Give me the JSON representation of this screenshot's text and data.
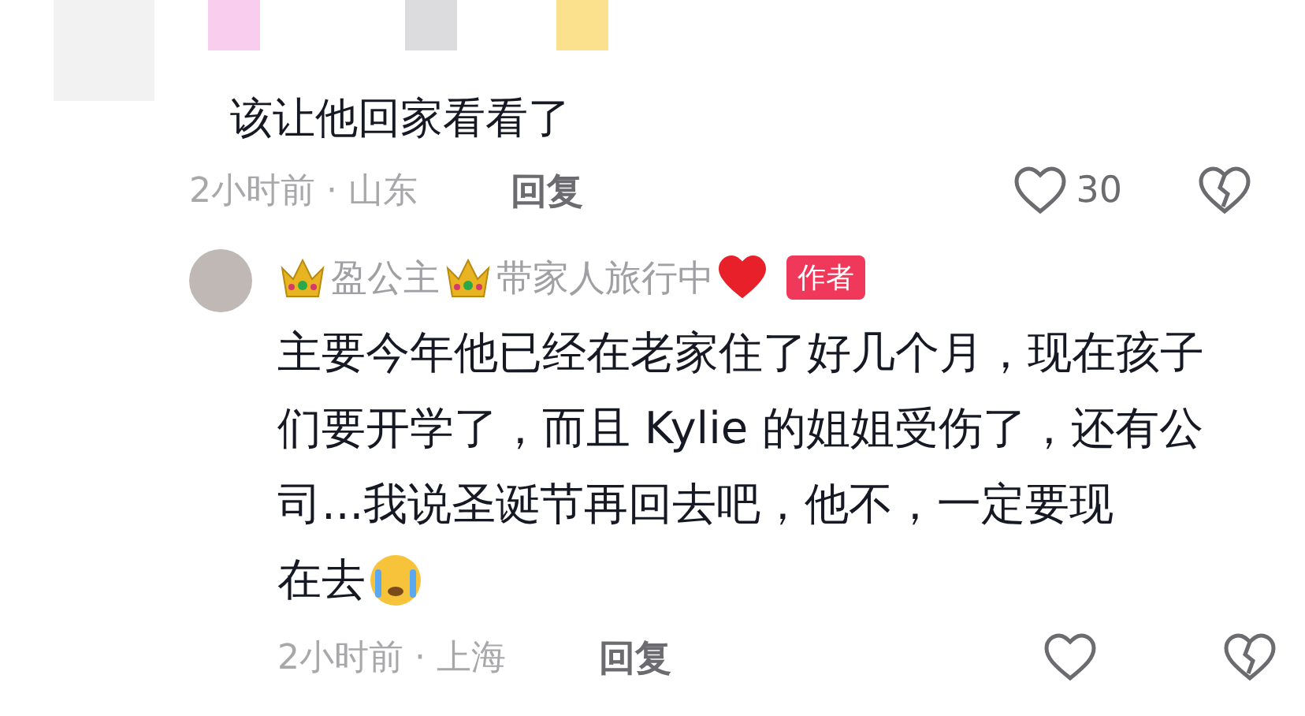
{
  "top_stickers": [
    {
      "color": "#f9cdee"
    },
    {
      "color": "#dcdcdf"
    },
    {
      "color": "#fbe08e"
    }
  ],
  "comment": {
    "text": "该让他回家看看了",
    "meta": "2小时前 · 山东",
    "reply": "回复",
    "likes": "30"
  },
  "reply": {
    "name_parts": [
      "盈公主",
      "带家人旅行中"
    ],
    "badge": "作者",
    "text": "主要今年他已经在老家住了好几个月，现在孩子们要开学了，而且 Kylie 的姐姐受伤了，还有公司...我说圣诞节再回去吧，他不，一定要现",
    "text_end": "在去",
    "meta": "2小时前 · 上海",
    "reply": "回复"
  }
}
